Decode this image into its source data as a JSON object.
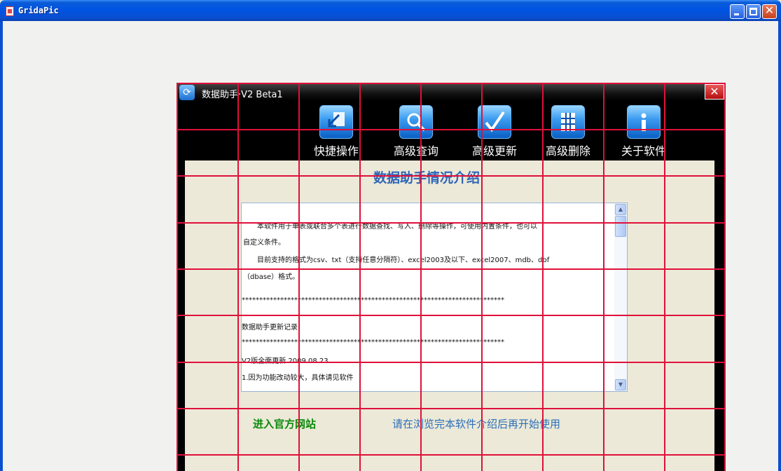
{
  "window": {
    "title": "GridaPic"
  },
  "app": {
    "title": "数据助手·V2 Beta1",
    "close_glyph": "✕",
    "toolbar": [
      {
        "label": "快捷操作",
        "icon": "quick-action-icon"
      },
      {
        "label": "高级查询",
        "icon": "magnifier-icon"
      },
      {
        "label": "高级更新",
        "icon": "checkmark-icon"
      },
      {
        "label": "高级删除",
        "icon": "delete-grid-icon"
      },
      {
        "label": "关于软件",
        "icon": "info-icon"
      }
    ],
    "heading": "数据助手情况介绍",
    "info_lines": [
      "　　本软件用于单表或联合多个表进行数据查找、写入、删除等操作，可使用内置条件，也可以",
      "自定义条件。",
      "　　目前支持的格式为csv、txt（支持任意分隔符）、excel2003及以下、excel2007、mdb、dbf",
      "（dbase）格式。",
      "***************************************************************************",
      "数据助手更新记录",
      "***************************************************************************",
      "V2版全面更新  2009.08.23",
      "1.因为功能改动较大，具体请见软件"
    ],
    "link_site": "进入官方网站",
    "notice": "请在浏览完本软件介绍后再开始使用"
  },
  "colors": {
    "grid": "#e0103a",
    "heading": "#2e66b8",
    "link": "#0a8a0a",
    "notice": "#2b6fb8"
  }
}
